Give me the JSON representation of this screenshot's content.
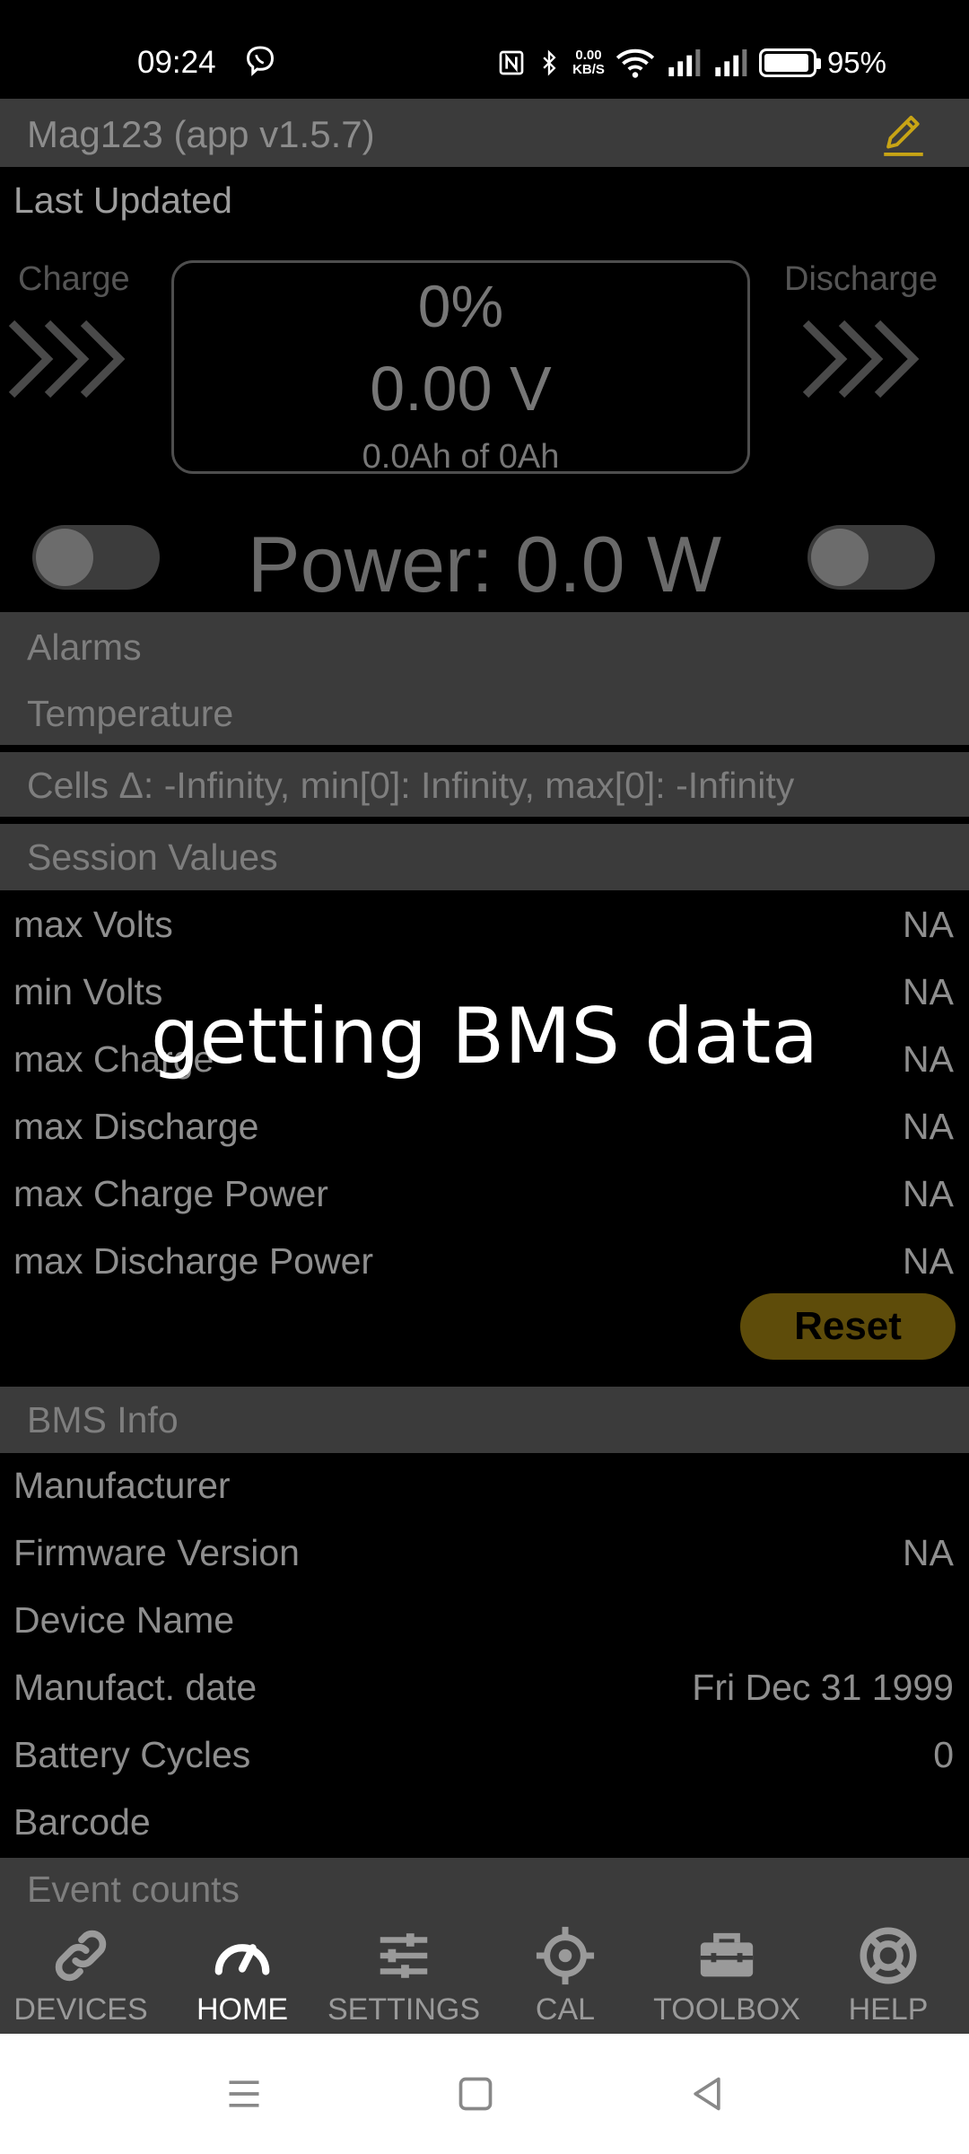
{
  "status_bar": {
    "time": "09:24",
    "net_speed_value": "0.00",
    "net_speed_unit": "KB/S",
    "battery_pct": "95%",
    "battery_level": 0.95
  },
  "title_bar": {
    "title": "Mag123 (app v1.5.7)"
  },
  "last_updated_label": "Last Updated",
  "gauge": {
    "charge_label": "Charge",
    "discharge_label": "Discharge",
    "percent": "0%",
    "voltage": "0.00 V",
    "capacity": "0.0Ah of 0Ah"
  },
  "power": {
    "text": "Power: 0.0 W"
  },
  "alarms": {
    "title": "Alarms",
    "temperature": "Temperature"
  },
  "cells": {
    "text": "Cells Δ: -Infinity, min[0]: Infinity, max[0]: -Infinity"
  },
  "session": {
    "title": "Session Values",
    "rows": [
      {
        "label": "max Volts",
        "value": "NA"
      },
      {
        "label": "min Volts",
        "value": "NA"
      },
      {
        "label": "max Charge",
        "value": "NA"
      },
      {
        "label": "max Discharge",
        "value": "NA"
      },
      {
        "label": "max Charge Power",
        "value": "NA"
      },
      {
        "label": "max Discharge Power",
        "value": "NA"
      }
    ],
    "reset_label": "Reset"
  },
  "overlay_message": "getting BMS data",
  "bms_info": {
    "title": "BMS Info",
    "rows": [
      {
        "label": "Manufacturer",
        "value": ""
      },
      {
        "label": "Firmware Version",
        "value": "NA"
      },
      {
        "label": "Device Name",
        "value": ""
      },
      {
        "label": "Manufact. date",
        "value": "Fri Dec 31 1999"
      },
      {
        "label": "Battery Cycles",
        "value": "0"
      },
      {
        "label": "Barcode",
        "value": ""
      }
    ]
  },
  "event_counts": {
    "title": "Event counts"
  },
  "nav": {
    "items": [
      {
        "label": "DEVICES",
        "icon": "link-icon"
      },
      {
        "label": "HOME",
        "icon": "speedometer-icon"
      },
      {
        "label": "SETTINGS",
        "icon": "sliders-icon"
      },
      {
        "label": "CAL",
        "icon": "crosshair-icon"
      },
      {
        "label": "TOOLBOX",
        "icon": "toolbox-icon"
      },
      {
        "label": "HELP",
        "icon": "lifebuoy-icon"
      }
    ],
    "active": "HOME"
  },
  "colors": {
    "accent": "#c8a415",
    "header_bg": "#3b3b3b",
    "reset_bg": "#5e4c0a"
  }
}
